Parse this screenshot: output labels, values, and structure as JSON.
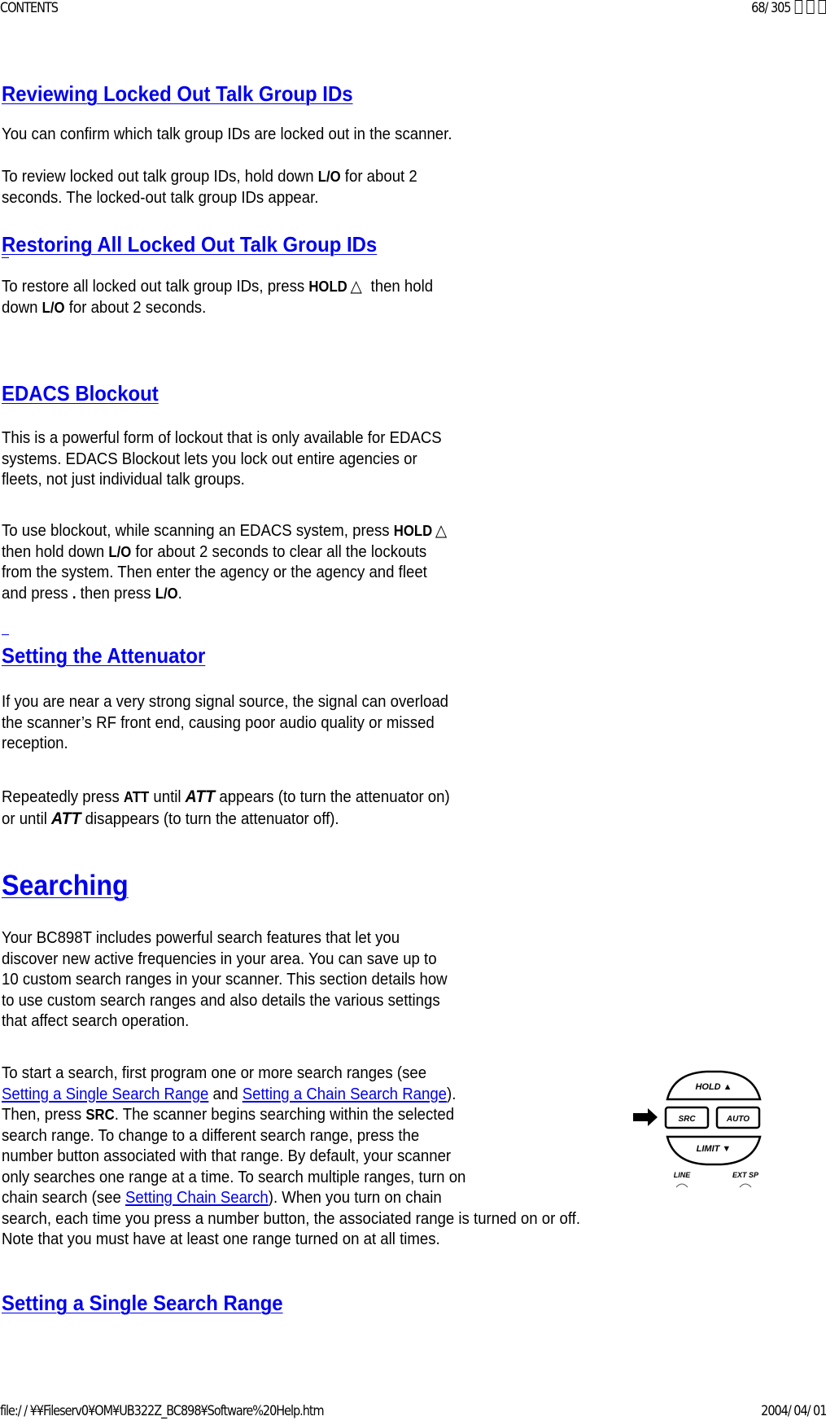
{
  "header": {
    "left": "CONTENTS",
    "page_current": "68",
    "page_total": "305",
    "page_separator": "/ "
  },
  "footer": {
    "path": "file://\\\\Fileserv0\\OM\\UB322Z_BC898\\Software%20Help.htm",
    "path_display": "file:/ / ¥¥Fileserv0¥OM¥UB322Z_BC898¥Software%20Help.htm",
    "date": "2004/ 04/ 01"
  },
  "sections": {
    "reviewing": {
      "heading": "Reviewing Locked Out Talk Group IDs",
      "p1": "You can confirm which talk group IDs are locked out in the scanner.",
      "p2_a": "To review locked out talk group IDs, hold down ",
      "p2_key": "L/O",
      "p2_b": " for about 2",
      "p2_line2": "seconds. The locked-out talk group IDs appear."
    },
    "restoring": {
      "heading": "Restoring All Locked Out Talk Group IDs",
      "p1_a": "To restore all locked out talk group IDs, press ",
      "p1_key1": "HOLD",
      "triangle": "△",
      "p1_b": " then hold",
      "p1_line2_a": "down ",
      "p1_key2": "L/O",
      "p1_line2_b": " for about 2 seconds."
    },
    "edacs": {
      "heading": "EDACS Blockout",
      "p1_l1": "This is a powerful form of lockout that is only available for EDACS",
      "p1_l2": "systems. EDACS Blockout lets you lock out entire agencies or",
      "p1_l3": "fleets, not just individual talk groups.",
      "p2_l1_a": "To use blockout, while scanning an EDACS system, press ",
      "p2_key1": "HOLD",
      "triangle": "△",
      "p2_l2_a": " then hold down ",
      "p2_key2": "L/O",
      "p2_l2_b": " for about 2 seconds to clear all the lockouts",
      "p2_l3": "from the system. Then enter the agency or the agency and fleet",
      "p2_l4_a": "and press ",
      "p2_key3": ".",
      "p2_l4_b": " then press ",
      "p2_key4": "L/O",
      "p2_l4_c": "."
    },
    "attenuator": {
      "heading": "Setting the Attenuator",
      "p1_l1": "If you are near a very strong signal source, the signal can overload",
      "p1_l2": "the scanner’s RF front end, causing poor audio quality or missed",
      "p1_l3": "reception.",
      "p2_l1_a": "Repeatedly press ",
      "p2_key1": "ATT",
      "p2_l1_b": " until ",
      "p2_disp1": "ATT",
      "p2_l1_c": " appears (to turn the attenuator on)",
      "p2_l2_a": "or until ",
      "p2_disp2": "ATT",
      "p2_l2_b": " disappears (to turn the attenuator off)."
    },
    "searching": {
      "heading": "Searching",
      "p1_l1": "Your BC898T includes powerful search features that let you",
      "p1_l2": "discover new active frequencies in your area. You can save up to",
      "p1_l3": "10 custom search ranges in your scanner. This section details how",
      "p1_l4": "to use custom search ranges and also details the various settings",
      "p1_l5": "that affect search operation.",
      "p2_l1": "To start a search, first program one or more search ranges (see",
      "link1": "Setting a Single Search Range",
      "and": " and ",
      "link2": "Setting a Chain Search Range",
      "p2_l2_end": ").",
      "p2_l3_a": "Then, press ",
      "p2_key": "SRC",
      "p2_l3_b": ". The scanner begins searching within the selected",
      "p2_l4": "search range. To change to a different search range, press the",
      "p2_l5": "number button associated with that range. By default, your scanner",
      "p2_l6": "only searches one range at a time. To search multiple ranges, turn on",
      "p2_l7_a": "chain search (see ",
      "link3": "Setting  Chain Search",
      "p2_l7_b": "). When you turn on chain",
      "p2_l8": "search, each time you press a number button, the associated range is turned on or off.",
      "p2_l9": "Note that you must have at least one range turned on at all times."
    },
    "single_range": {
      "heading": "Setting a Single Search Range"
    }
  },
  "panel": {
    "hold": "HOLD ▲",
    "src": "SRC",
    "auto": "AUTO",
    "limit": "LIMIT ▼",
    "line": "LINE",
    "ext_sp": "EXT SP"
  },
  "colors": {
    "link": "#0000ee",
    "text": "#000000",
    "background": "#ffffff"
  }
}
